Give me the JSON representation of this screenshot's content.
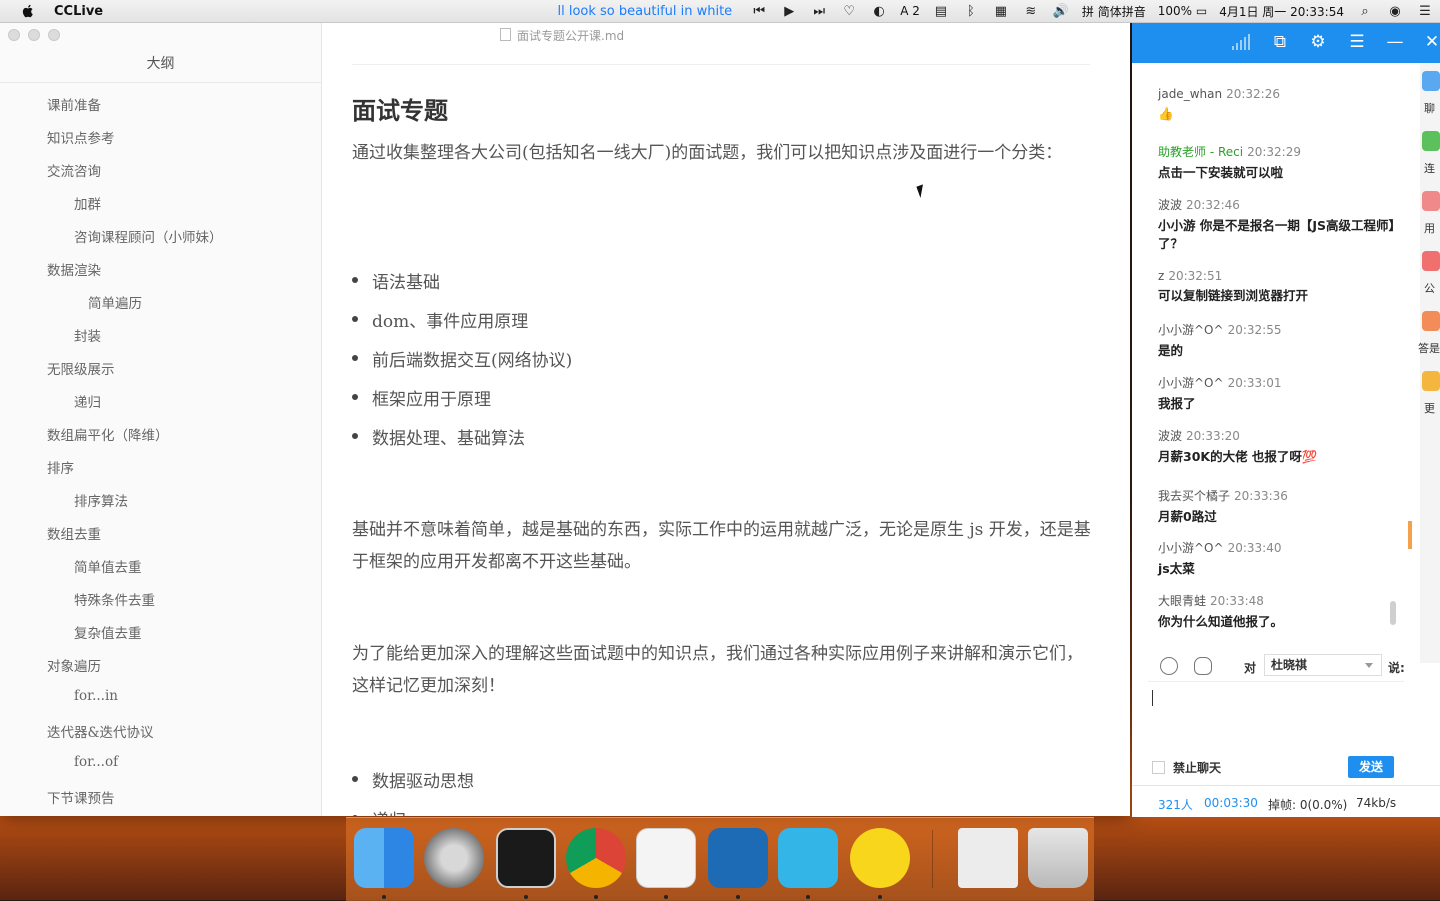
{
  "menubar": {
    "app_name": "CCLive",
    "now_playing_prefix": "ll",
    "now_playing": "look so beautiful in white",
    "num_indicator": "2",
    "input_method": "简体拼音",
    "battery": "100%",
    "datetime": "4月1日 周一  20:33:54"
  },
  "typora": {
    "file_name": "面试专题公开课.md",
    "outline_title": "大纲",
    "outline": [
      {
        "label": "课前准备",
        "level": 1
      },
      {
        "label": "知识点参考",
        "level": 1
      },
      {
        "label": "交流咨询",
        "level": 1
      },
      {
        "label": "加群",
        "level": 2
      },
      {
        "label": "咨询课程顾问（小师妹）",
        "level": 2
      },
      {
        "label": "数据渲染",
        "level": 1
      },
      {
        "label": "简单遍历",
        "level": 3
      },
      {
        "label": "封装",
        "level": 2
      },
      {
        "label": "无限级展示",
        "level": 1
      },
      {
        "label": "递归",
        "level": 2
      },
      {
        "label": "数组扁平化（降维）",
        "level": 1
      },
      {
        "label": "排序",
        "level": 1
      },
      {
        "label": "排序算法",
        "level": 2
      },
      {
        "label": "数组去重",
        "level": 1
      },
      {
        "label": "简单值去重",
        "level": 2
      },
      {
        "label": "特殊条件去重",
        "level": 2
      },
      {
        "label": "复杂值去重",
        "level": 2
      },
      {
        "label": "对象遍历",
        "level": 1
      },
      {
        "label": "for...in",
        "level": 2
      },
      {
        "label": "迭代器&迭代协议",
        "level": 1
      },
      {
        "label": "for...of",
        "level": 2
      },
      {
        "label": "下节课预告",
        "level": 1
      }
    ],
    "heading": "面试专题",
    "intro": "通过收集整理各大公司(包括知名一线大厂)的面试题，我们可以把知识点涉及面进行一个分类：",
    "bullets": [
      "语法基础",
      "dom、事件应用原理",
      "前后端数据交互(网络协议)",
      "框架应用于原理",
      "数据处理、基础算法"
    ],
    "para2": "基础并不意味着简单，越是基础的东西，实际工作中的运用就越广泛，无论是原生 js 开发，还是基于框架的应用开发都离不开这些基础。",
    "para3": "为了能给更加深入的理解这些面试题中的知识点，我们通过各种实际应用例子来讲解和演示它们，这样记忆更加深刻！",
    "bullets2": [
      "数据驱动思想",
      "递归"
    ]
  },
  "chat": {
    "messages": [
      {
        "user": "jade_whan",
        "time": "20:32:26",
        "text": "👍",
        "role": "student"
      },
      {
        "user": "助教老师 - Reci",
        "time": "20:32:29",
        "text": "点击一下安装就可以啦",
        "role": "teacher"
      },
      {
        "user": "波波",
        "time": "20:32:46",
        "text": "小小游  你是不是报名一期【JS高级工程师】了？",
        "role": "student"
      },
      {
        "user": "z",
        "time": "20:32:51",
        "text": "可以复制链接到浏览器打开",
        "role": "student"
      },
      {
        "user": "小小游^O^",
        "time": "20:32:55",
        "text": "是的",
        "role": "student"
      },
      {
        "user": "小小游^O^",
        "time": "20:33:01",
        "text": "我报了",
        "role": "student"
      },
      {
        "user": "波波",
        "time": "20:33:20",
        "text": "月薪30K的大佬  也报了呀💯",
        "role": "student"
      },
      {
        "user": "我去买个橘子",
        "time": "20:33:36",
        "text": "月薪0路过",
        "role": "student"
      },
      {
        "user": "小小游^O^",
        "time": "20:33:40",
        "text": "js太菜",
        "role": "student"
      },
      {
        "user": "大眼青蛙",
        "time": "20:33:48",
        "text": "你为什么知道他报了。",
        "role": "student"
      }
    ],
    "side_labels": [
      "聊",
      "连",
      "用",
      "公",
      "答是",
      "更"
    ],
    "to_label": "对",
    "recipient": "杜晓祺",
    "say_label": "说:",
    "mute_label": "禁止聊天",
    "send_label": "发送",
    "status": {
      "count": "321人",
      "elapsed": "00:03:30",
      "dropped": "掉帧: 0(0.0%)",
      "speed": "74kb/s"
    }
  },
  "dock": {
    "apps": [
      "finder-icon",
      "launchpad-icon",
      "terminal-icon",
      "chrome-icon",
      "typora-icon",
      "vscode-icon",
      "cclive-icon",
      "qqmusic-icon",
      "documents-icon",
      "trash-icon"
    ]
  }
}
